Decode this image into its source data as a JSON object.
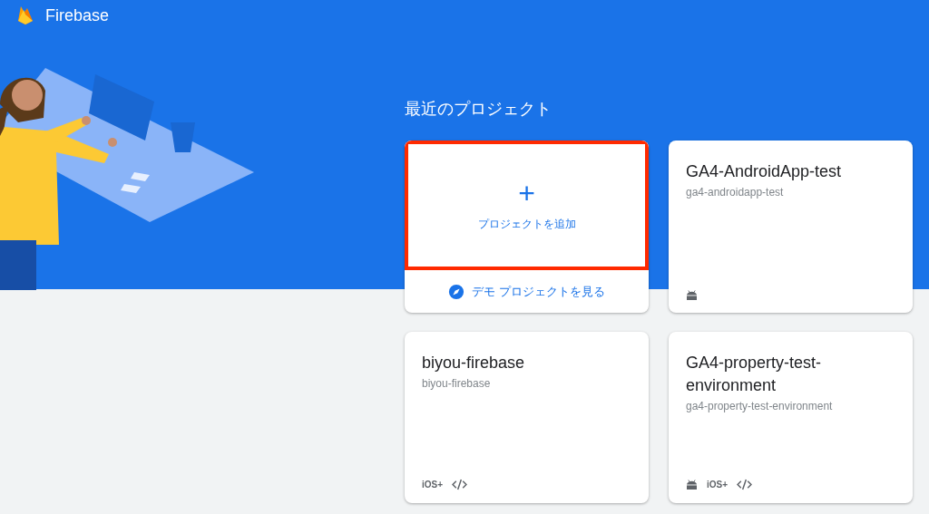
{
  "header": {
    "product": "Firebase"
  },
  "section_title": "最近のプロジェクト",
  "add_card": {
    "icon": "+",
    "label": "プロジェクトを追加",
    "highlighted": true,
    "demo_link": "デモ プロジェクトを見る"
  },
  "projects": [
    {
      "name": "GA4-AndroidApp-test",
      "id": "ga4-androidapp-test",
      "platforms": [
        {
          "kind": "android"
        }
      ]
    },
    {
      "name": "biyou-firebase",
      "id": "biyou-firebase",
      "platforms": [
        {
          "kind": "ios",
          "label": "iOS+"
        },
        {
          "kind": "web"
        }
      ]
    },
    {
      "name": "GA4-property-test-environment",
      "id": "ga4-property-test-environment",
      "platforms": [
        {
          "kind": "android"
        },
        {
          "kind": "ios",
          "label": "iOS+"
        },
        {
          "kind": "web"
        }
      ]
    }
  ]
}
